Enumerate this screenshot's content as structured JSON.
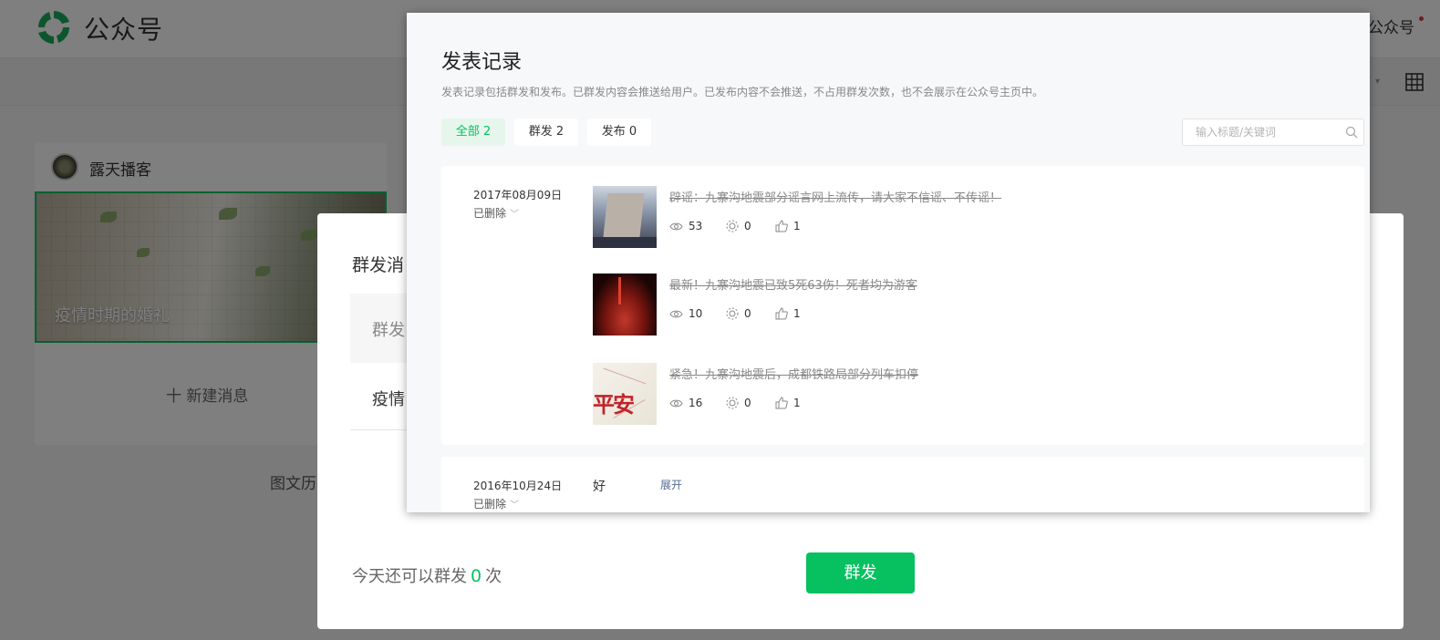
{
  "topbar": {
    "logo_text": "公众号",
    "account_label": "公众号"
  },
  "editor": {
    "account_name": "露天播客",
    "cover_title": "疫情时期的婚礼",
    "new_message": "十  新建消息",
    "history_label": "图文历"
  },
  "mass_dialog": {
    "title": "群发消",
    "row1_label": "群发",
    "row2_label": "疫情",
    "quota_prefix": "今天还可以群发",
    "quota_count": "0",
    "quota_suffix": "次",
    "send_label": "群发"
  },
  "records": {
    "title": "发表记录",
    "description": "发表记录包括群发和发布。已群发内容会推送给用户。已发布内容不会推送，不占用群发次数，也不会展示在公众号主页中。",
    "tabs": [
      {
        "label": "全部 2",
        "active": true
      },
      {
        "label": "群发 2",
        "active": false
      },
      {
        "label": "发布 0",
        "active": false
      }
    ],
    "search": {
      "placeholder": "输入标题/关键词"
    },
    "groups": [
      {
        "date": "2017年08月09日",
        "status": "已删除",
        "articles": [
          {
            "title": "辟谣：九寨沟地震部分谣言网上流传，请大家不信谣、不传谣！",
            "views": "53",
            "shares": "0",
            "likes": "1"
          },
          {
            "title": "最新！九寨沟地震已致5死63伤！死者均为游客",
            "views": "10",
            "shares": "0",
            "likes": "1"
          },
          {
            "title": "紧急！九寨沟地震后，成都铁路局部分列车扣停",
            "views": "16",
            "shares": "0",
            "likes": "1"
          }
        ]
      },
      {
        "date": "2016年10月24日",
        "status": "已删除",
        "text": "好",
        "expand_label": "展开"
      }
    ],
    "thumb3_text": "平安"
  },
  "colors": {
    "accent": "#07c160",
    "link": "#576b95",
    "dot": "#d9363e"
  }
}
